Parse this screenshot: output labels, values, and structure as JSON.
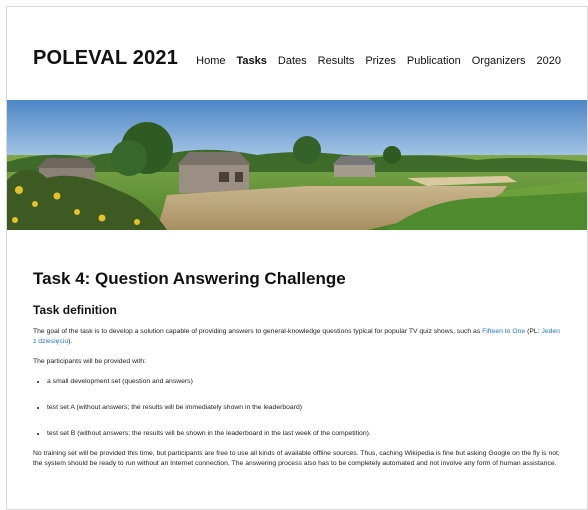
{
  "header": {
    "brand": "POLEVAL 2021",
    "nav": [
      {
        "label": "Home",
        "active": false
      },
      {
        "label": "Tasks",
        "active": true
      },
      {
        "label": "Dates",
        "active": false
      },
      {
        "label": "Results",
        "active": false
      },
      {
        "label": "Prizes",
        "active": false
      },
      {
        "label": "Publication",
        "active": false
      },
      {
        "label": "Organizers",
        "active": false
      },
      {
        "label": "2020",
        "active": false
      }
    ]
  },
  "main": {
    "title": "Task 4: Question Answering Challenge",
    "section_heading": "Task definition",
    "intro": {
      "before": "The goal of the task is to develop a solution capable of providing answers to general-knowledge questions typical for popular TV quiz shows, such as ",
      "link1": "Fifteen to One",
      "middle": " (PL: ",
      "link2": "Jeden z dziesięciu",
      "after": ")."
    },
    "participants_intro": "The participants will be provided with:",
    "list": [
      "a small development set (question and answers)",
      "test set A (without answers; the results will be immediately shown in the leaderboard)",
      "test set B (without answers; the results will be shown in the leaderboard in the last week of the competition)."
    ],
    "closing": "No training set will be provided this time, but participants are free to use all kinds of available offline sources. Thus, caching Wikipedia is fine but asking Google on the fly is not; the system should be ready to run without an Internet connection. The answering process also has to be completely automated and not involve any form of human assistance."
  },
  "colors": {
    "link": "#2a7ad1",
    "text": "#111111"
  }
}
